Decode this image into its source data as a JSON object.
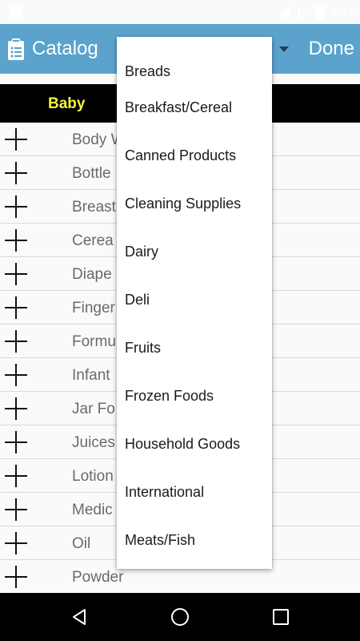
{
  "status_bar": {
    "time": "1:33",
    "icons": [
      "notification-icon",
      "wifi-icon",
      "signal-icon",
      "battery-icon"
    ]
  },
  "app_bar": {
    "title": "Catalog",
    "done_label": "Done",
    "icon": "clipboard-icon"
  },
  "section": {
    "title": "Baby"
  },
  "list": {
    "items": [
      "Body W",
      "Bottle",
      "Breast",
      "Cerea",
      "Diape",
      "Finger",
      "Formu",
      "Infant",
      "Jar Fo",
      "Juices",
      "Lotion",
      "Medic",
      "Oil",
      "Powder"
    ]
  },
  "dropdown": {
    "options": [
      "Breads",
      "Breakfast/Cereal",
      "Canned Products",
      "Cleaning Supplies",
      "Dairy",
      "Deli",
      "Fruits",
      "Frozen Foods",
      "Household Goods",
      "International",
      "Meats/Fish"
    ]
  },
  "nav_bar": {
    "buttons": [
      "back-icon",
      "home-icon",
      "recents-icon"
    ]
  },
  "colors": {
    "app_bar": "#5ba3cd",
    "section_header": "#000000",
    "section_text": "#f6f43e",
    "nav_bar": "#000000"
  }
}
